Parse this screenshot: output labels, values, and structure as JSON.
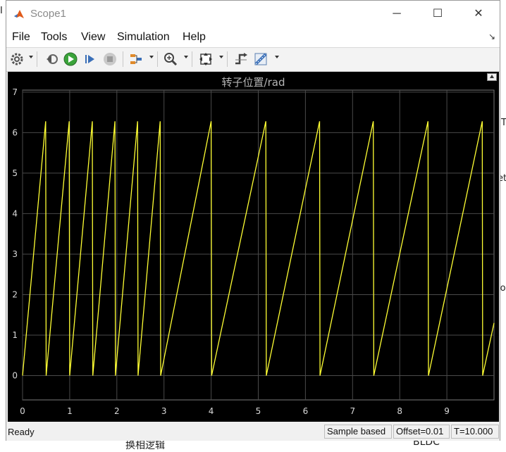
{
  "window": {
    "title": "Scope1",
    "controls": {
      "minimize": "─",
      "maximize": "☐",
      "close": "✕"
    }
  },
  "menu": {
    "items": [
      "File",
      "Tools",
      "View",
      "Simulation",
      "Help"
    ],
    "overflow_icon": "dock-arrow-icon"
  },
  "toolbar": {
    "buttons": [
      "gear-icon",
      "step-back-icon",
      "run-icon",
      "step-forward-icon",
      "stop-icon",
      "highlight-icon",
      "zoom-icon",
      "autoscale-icon",
      "triggers-icon",
      "measurements-icon"
    ]
  },
  "background_fragments": {
    "top_left": "I",
    "right_1": "T",
    "right_2": "et",
    "right_3": "io",
    "bottom_center": "换相逻辑",
    "bottom_right": "BLDC"
  },
  "status": {
    "ready": "Ready",
    "sample": "Sample based",
    "offset": "Offset=0.01",
    "time": "T=10.000"
  },
  "chart_data": {
    "type": "line",
    "title": "转子位置/rad",
    "xlabel": "",
    "ylabel": "",
    "xlim": [
      0,
      10
    ],
    "ylim": [
      -0.6,
      7.05
    ],
    "xticks": [
      0,
      1,
      2,
      3,
      4,
      5,
      6,
      7,
      8,
      9
    ],
    "yticks": [
      0,
      1,
      2,
      3,
      4,
      5,
      6,
      7
    ],
    "grid": true,
    "colors": {
      "background": "#000000",
      "grid": "#4a4a4a",
      "axes": "#7a7a7a",
      "line": "#ffff33",
      "tick_labels": "#d8d8d8"
    },
    "series": [
      {
        "x": [
          0,
          0.49,
          0.5,
          0.99,
          1.0,
          1.48,
          1.49,
          1.96,
          1.97,
          2.44,
          2.45,
          2.92,
          2.93,
          4.0,
          4.01,
          5.16,
          5.17,
          6.3,
          6.31,
          7.44,
          7.45,
          8.6,
          8.61,
          9.75,
          9.76,
          10.0
        ],
        "y": [
          0,
          6.28,
          0,
          6.28,
          0,
          6.28,
          0,
          6.28,
          0,
          6.28,
          0,
          6.28,
          0,
          6.28,
          0,
          6.28,
          0,
          6.28,
          0,
          6.28,
          0,
          6.28,
          0,
          6.28,
          0,
          1.3
        ]
      }
    ]
  }
}
